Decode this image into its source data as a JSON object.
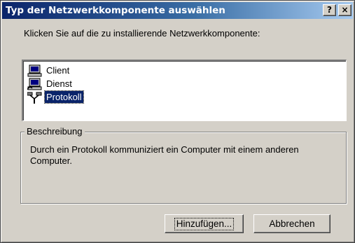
{
  "window": {
    "title": "Typ der Netzwerkkomponente auswählen",
    "help_button": "?",
    "close_button": "×"
  },
  "prompt": "Klicken Sie auf die zu installierende Netzwerkkomponente:",
  "components": [
    {
      "label": "Client",
      "icon": "client-computer-icon",
      "selected": false
    },
    {
      "label": "Dienst",
      "icon": "service-computer-icon",
      "selected": false
    },
    {
      "label": "Protokoll",
      "icon": "protocol-network-icon",
      "selected": true
    }
  ],
  "description": {
    "legend": "Beschreibung",
    "text": "Durch ein Protokoll kommuniziert ein Computer mit einem anderen Computer."
  },
  "buttons": {
    "add_label": "Hinzufügen...",
    "cancel_label": "Abbrechen"
  },
  "colors": {
    "titlebar_start": "#0a246a",
    "titlebar_end": "#a6caf0",
    "face": "#d4d0c8",
    "selection": "#0a246a"
  }
}
